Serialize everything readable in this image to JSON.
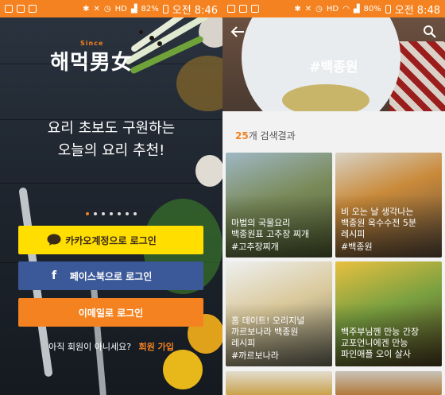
{
  "left_screen": {
    "status": {
      "battery": "82%",
      "time": "오전 8:46",
      "hd": "HD"
    },
    "logo": {
      "text": "해먹男女",
      "small": "Since"
    },
    "tagline": [
      "요리 초보도 구원하는",
      "오늘의 요리 추천!"
    ],
    "buttons": {
      "kakao": "카카오계정으로 로그인",
      "facebook": "페이스북으로 로그인",
      "email": "이메일로 로그인"
    },
    "signup": {
      "prompt": "아직 회원이 아니세요?",
      "link": "회원 가입"
    },
    "colors": {
      "accent": "#f58220",
      "kakao": "#ffde00",
      "facebook": "#3b5998"
    }
  },
  "right_screen": {
    "status": {
      "battery": "80%",
      "time": "오전 8:48",
      "hd": "HD"
    },
    "header_title": "#백종원",
    "result_count": "25",
    "result_suffix": "개 검색결과",
    "cards": [
      {
        "title": "마법의 국물요리\n백종원표 고추장 찌개",
        "tag": "#고추장찌개"
      },
      {
        "title": "비 오는 날 생각나는\n백종원 옥수수전 5분\n레시피",
        "tag": "#백종원"
      },
      {
        "title": "홈 데이트! 오리지널\n까르보나라 백종원\n레시피",
        "tag": "#까르보나라"
      },
      {
        "title": "백주부님껜 만능 간장\n교포언니에겐 만능\n파인애플 오이 살사",
        "tag": ""
      }
    ]
  }
}
